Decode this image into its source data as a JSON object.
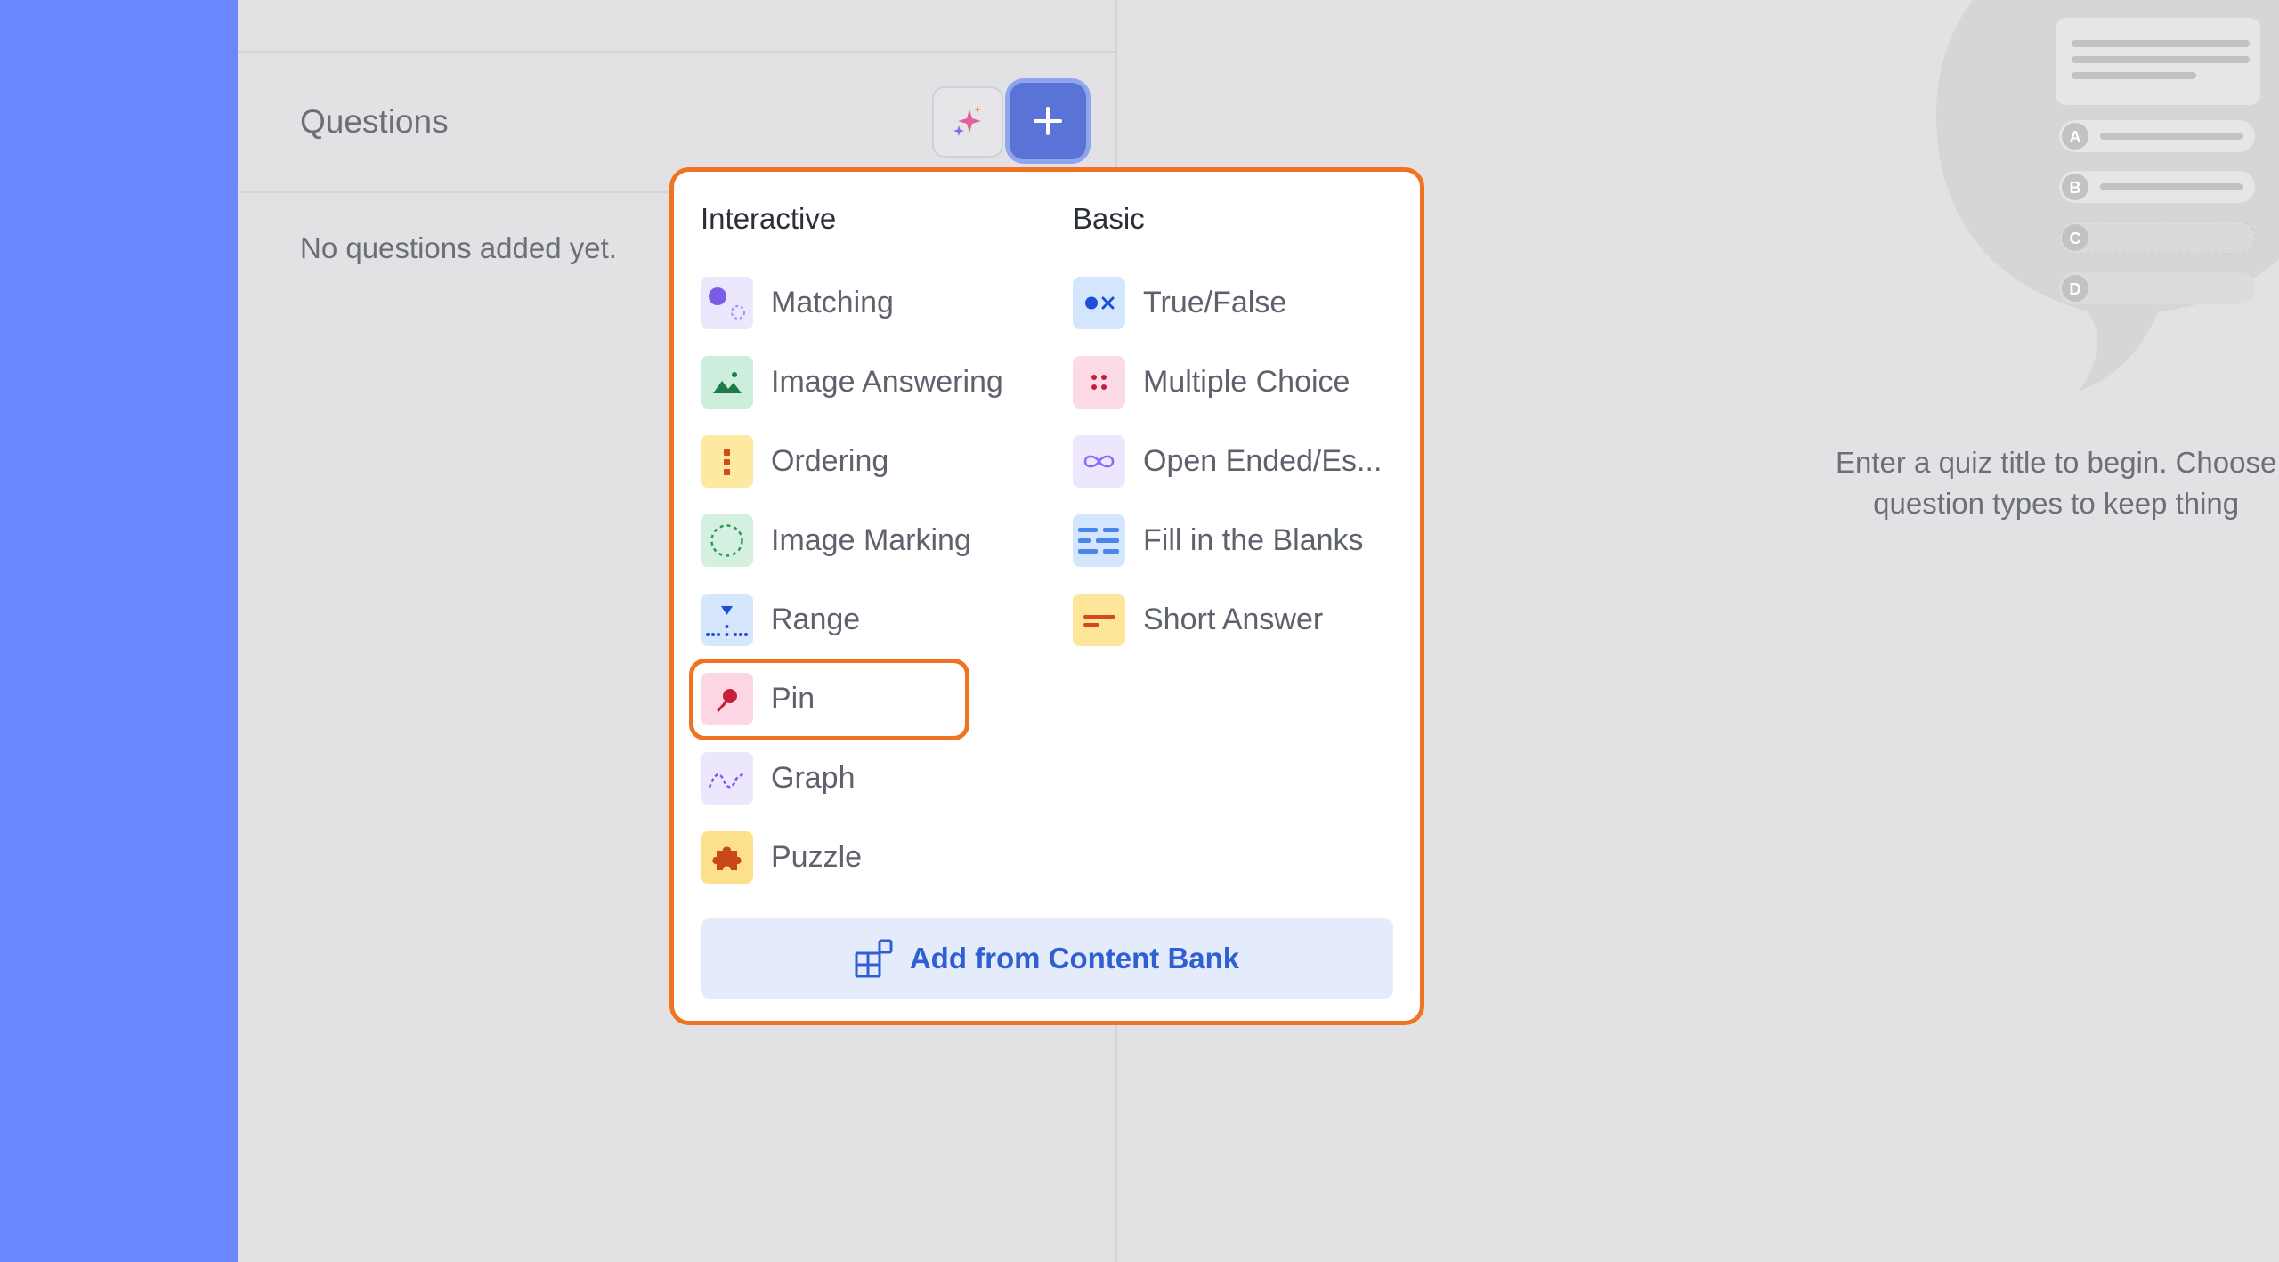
{
  "questions_panel": {
    "title": "Questions",
    "empty_message": "No questions added yet."
  },
  "right_panel": {
    "hint_line1": "Enter a quiz title to begin. Choose",
    "hint_line2": "question types to keep thing",
    "illustration_options": [
      "A",
      "B",
      "C",
      "D"
    ]
  },
  "menu": {
    "interactive_heading": "Interactive",
    "basic_heading": "Basic",
    "interactive_items": [
      {
        "label": "Matching",
        "icon": "matching-icon"
      },
      {
        "label": "Image Answering",
        "icon": "image-answering-icon"
      },
      {
        "label": "Ordering",
        "icon": "ordering-icon"
      },
      {
        "label": "Image Marking",
        "icon": "image-marking-icon"
      },
      {
        "label": "Range",
        "icon": "range-icon"
      },
      {
        "label": "Pin",
        "icon": "pin-icon"
      },
      {
        "label": "Graph",
        "icon": "graph-icon"
      },
      {
        "label": "Puzzle",
        "icon": "puzzle-icon"
      }
    ],
    "basic_items": [
      {
        "label": "True/False",
        "icon": "true-false-icon"
      },
      {
        "label": "Multiple Choice",
        "icon": "multiple-choice-icon"
      },
      {
        "label": "Open Ended/Es...",
        "icon": "open-ended-icon"
      },
      {
        "label": "Fill in the Blanks",
        "icon": "fill-blanks-icon"
      },
      {
        "label": "Short Answer",
        "icon": "short-answer-icon"
      }
    ],
    "content_bank_label": "Add from Content Bank"
  },
  "colors": {
    "accent_blue": "#6a87fe",
    "highlight_orange": "#f07322",
    "add_button": "#5a73d6"
  }
}
